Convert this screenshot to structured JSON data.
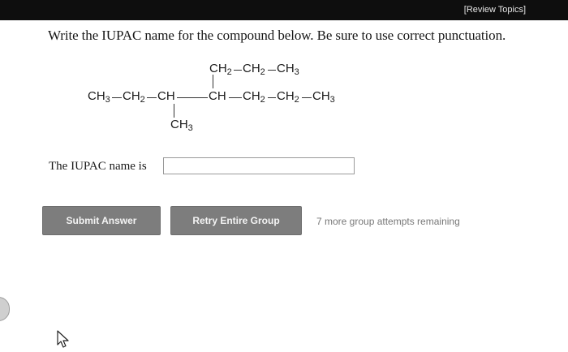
{
  "header": {
    "review_link": "[Review Topics]"
  },
  "question": {
    "prompt": "Write the IUPAC name for the compound below. Be sure to use correct punctuation."
  },
  "molecule": {
    "branch_top": {
      "ch2_a": "CH",
      "ch2_b": "CH",
      "ch3": "CH",
      "sub2": "2",
      "sub3": "3"
    },
    "main_chain": {
      "ch3_start": "CH",
      "ch2_1": "CH",
      "ch_1": "CH",
      "ch_2": "CH",
      "ch2_2": "CH",
      "ch2_3": "CH",
      "ch3_end": "CH",
      "sub2": "2",
      "sub3": "3"
    },
    "branch_bottom": {
      "ch3": "CH",
      "sub3": "3"
    }
  },
  "answer": {
    "label": "The IUPAC name is",
    "value": "",
    "placeholder": ""
  },
  "buttons": {
    "submit": "Submit Answer",
    "retry": "Retry Entire Group"
  },
  "status": {
    "attempts": "7 more group attempts remaining"
  },
  "icons": {
    "side_tab": "chevron-left-icon",
    "cursor": "mouse-pointer-icon"
  }
}
